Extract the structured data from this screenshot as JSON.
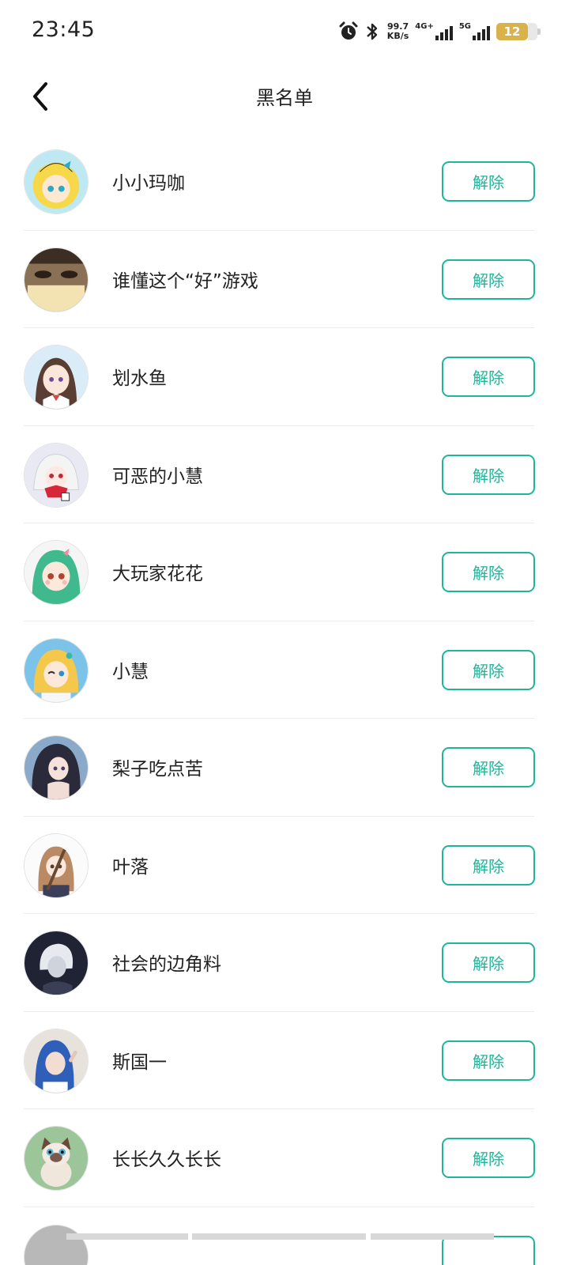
{
  "status_bar": {
    "time": "23:45",
    "speed_value": "99.7",
    "speed_unit": "KB/s",
    "net1_label": "4G+",
    "net2_label": "5G",
    "battery": "12"
  },
  "header": {
    "title": "黑名单"
  },
  "blocked_users": [
    {
      "name": "小小玛咖",
      "action": "解除",
      "avatar": "anime-blonde-girl"
    },
    {
      "name": "谁懂这个“好”游戏",
      "action": "解除",
      "avatar": "eyes-photo"
    },
    {
      "name": "划水鱼",
      "action": "解除",
      "avatar": "anime-brown-hair-girl"
    },
    {
      "name": "可恶的小慧",
      "action": "解除",
      "avatar": "anime-white-hair-girl"
    },
    {
      "name": "大玩家花花",
      "action": "解除",
      "avatar": "anime-green-hair-girl"
    },
    {
      "name": "小慧",
      "action": "解除",
      "avatar": "anime-wink-girl"
    },
    {
      "name": "梨子吃点苦",
      "action": "解除",
      "avatar": "anime-dark-hair-girl"
    },
    {
      "name": "叶落",
      "action": "解除",
      "avatar": "anime-guitar-girl"
    },
    {
      "name": "社会的边角料",
      "action": "解除",
      "avatar": "anime-white-hair-boy"
    },
    {
      "name": "斯国一",
      "action": "解除",
      "avatar": "photo-girl"
    },
    {
      "name": "长长久久长长",
      "action": "解除",
      "avatar": "siamese-cat"
    }
  ],
  "colors": {
    "accent": "#1fb59a",
    "text": "#222222",
    "divider": "#ececec",
    "battery": "#d9b24c"
  }
}
